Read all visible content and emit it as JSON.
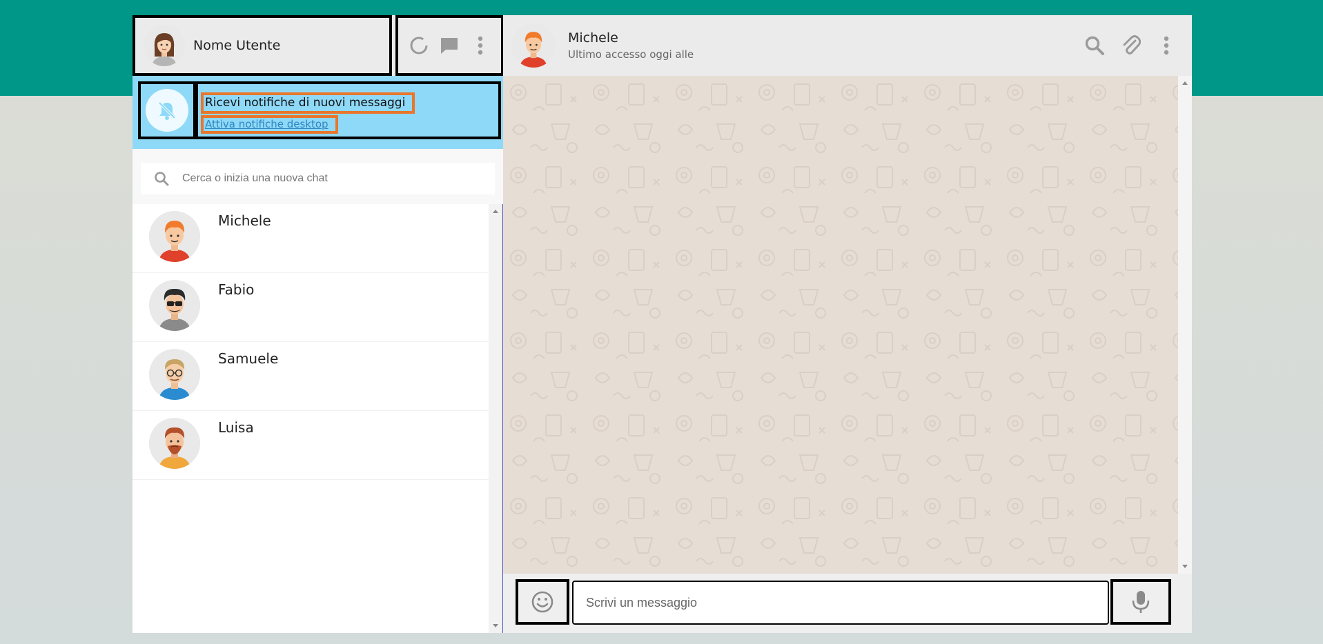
{
  "user": {
    "name": "Nome Utente",
    "avatar_icon": "user-female-avatar-icon"
  },
  "header_icons": [
    "status-icon",
    "new-chat-icon",
    "menu-dots-icon"
  ],
  "notification": {
    "title": "Ricevi notifiche di nuovi messaggi",
    "link": "Attiva notifiche desktop",
    "icon": "bell-off-icon"
  },
  "search": {
    "placeholder": "Cerca o inizia una nuova chat",
    "icon": "search-icon"
  },
  "contacts": [
    {
      "name": "Michele"
    },
    {
      "name": "Fabio"
    },
    {
      "name": "Samuele"
    },
    {
      "name": "Luisa"
    }
  ],
  "active_chat": {
    "name": "Michele",
    "status": "Ultimo accesso oggi alle",
    "icons": [
      "search-icon",
      "attach-icon",
      "menu-dots-icon"
    ]
  },
  "composer": {
    "placeholder": "Scrivi un messaggio",
    "emoji_icon": "emoji-icon",
    "mic_icon": "microphone-icon"
  },
  "colors": {
    "brand": "#009688",
    "notification_bg": "#8fd9f8",
    "header_bg": "#ebebeb",
    "chat_bg": "#e6ddd4",
    "highlight_orange": "#e8762c"
  }
}
